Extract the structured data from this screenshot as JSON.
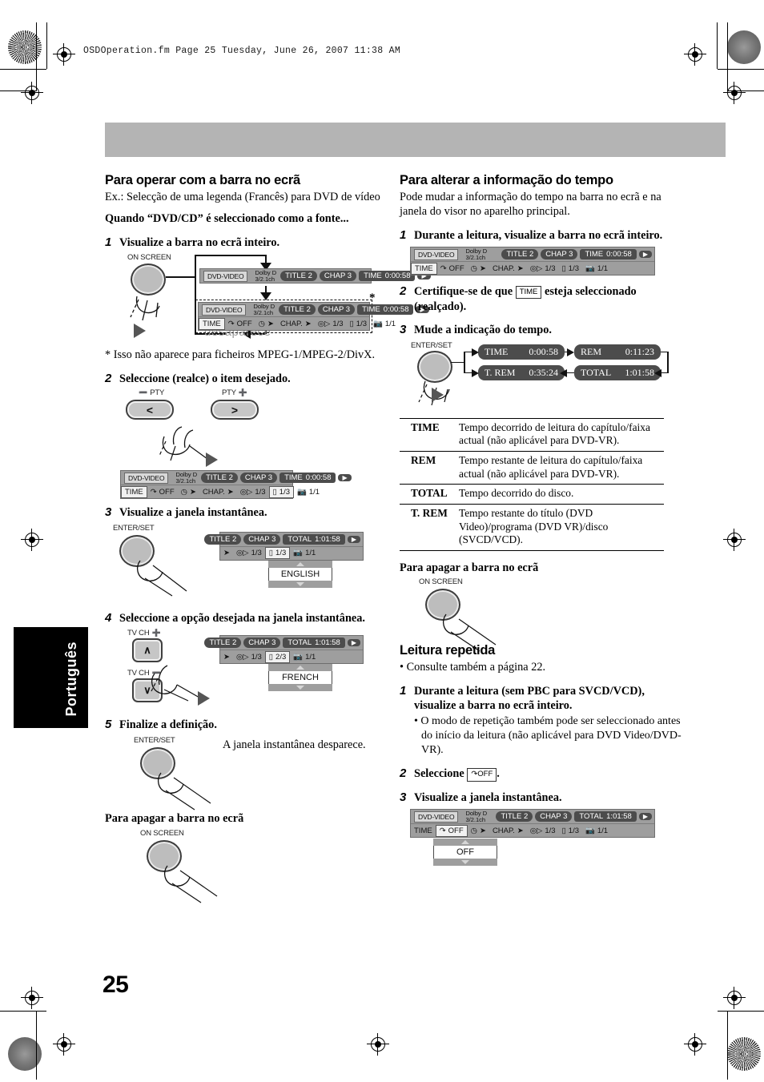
{
  "page": {
    "running_header": "OSDOperation.fm  Page 25  Tuesday, June 26, 2007   11:38 AM",
    "number": "25",
    "language_tab": "Português"
  },
  "left": {
    "heading": "Para operar com a barra no ecrã",
    "intro": "Ex.: Selecção de uma legenda (Francês) para DVD de vídeo",
    "subheading": "Quando “DVD/CD” é seleccionado como a fonte...",
    "step1": {
      "num": "1",
      "text": "Visualize a barra no ecrã inteiro."
    },
    "on_screen_label": "ON SCREEN",
    "disappear_label": "desaparece",
    "footnote": "* Isso não aparece para ficheiros MPEG-1/MPEG-2/DivX.",
    "step2": {
      "num": "2",
      "text": "Seleccione (realce) o item desejado."
    },
    "pty_minus": "PTY",
    "pty_plus": "PTY",
    "btn_left": "<",
    "btn_right": ">",
    "step3": {
      "num": "3",
      "text": "Visualize a janela instantânea."
    },
    "enter_set_label": "ENTER/SET",
    "popup_english": "ENGLISH",
    "step4": {
      "num": "4",
      "text": "Seleccione a opção desejada na janela instantânea."
    },
    "tvch_up": "TV CH",
    "tvch_dn": "TV CH",
    "btn_up": "∧",
    "btn_dn": "∨",
    "popup_french": "FRENCH",
    "step5": {
      "num": "5",
      "text": "Finalize a definição."
    },
    "step5_note": "A janela instantânea desparece.",
    "erase_heading": "Para apagar a barra no ecrã"
  },
  "right": {
    "heading": "Para alterar a informação do tempo",
    "intro": "Pode mudar a informação do tempo na barra no ecrã e na janela do visor no aparelho principal.",
    "step1": {
      "num": "1",
      "text": "Durante a leitura, visualize a barra no ecrã inteiro."
    },
    "step2": {
      "num": "2",
      "text_a": "Certifique-se de que",
      "chip": "TIME",
      "text_b": "esteja seleccionado (realçado)."
    },
    "step3": {
      "num": "3",
      "text": "Mude a indicação do tempo."
    },
    "enter_set_label": "ENTER/SET",
    "cycle": [
      {
        "label": "TIME",
        "value": "0:00:58"
      },
      {
        "label": "REM",
        "value": "0:11:23"
      },
      {
        "label": "TOTAL",
        "value": "1:01:58"
      },
      {
        "label": "T. REM",
        "value": "0:35:24"
      }
    ],
    "table": {
      "rows": [
        {
          "key": "TIME",
          "desc": "Tempo decorrido de leitura do capítulo/faixa actual (não aplicável para DVD-VR)."
        },
        {
          "key": "REM",
          "desc": "Tempo restante de leitura do capítulo/faixa actual (não aplicável para DVD-VR)."
        },
        {
          "key": "TOTAL",
          "desc": "Tempo decorrido do disco."
        },
        {
          "key": "T. REM",
          "desc": "Tempo restante do título (DVD Video)/programa (DVD VR)/disco (SVCD/VCD)."
        }
      ]
    },
    "erase_heading": "Para apagar a barra no ecrã",
    "on_screen_label": "ON SCREEN",
    "repeat_heading": "Leitura repetida",
    "repeat_bullet": "• Consulte também a página 22.",
    "rstep1": {
      "num": "1",
      "text": "Durante a leitura (sem PBC para SVCD/VCD), visualize a barra no ecrã inteiro.",
      "bullet": "• O modo de repetição também pode ser seleccionado antes do início da leitura (não aplicável para DVD Video/DVD-VR)."
    },
    "rstep2": {
      "num": "2",
      "text_a": "Seleccione",
      "chip": "OFF",
      "text_b": "."
    },
    "rstep3": {
      "num": "3",
      "text": "Visualize a janela instantânea."
    },
    "popup_off": "OFF"
  },
  "osd": {
    "media": "DVD-VIDEO",
    "dolby_line1": "Dolby D",
    "dolby_line2": "3/2.1ch",
    "title": "TITLE 2",
    "chap": "CHAP 3",
    "time_label": "TIME",
    "time_value": "0:00:58",
    "total_label": "TOTAL",
    "total_value": "1:01:58",
    "row2_time": "TIME",
    "row2_repeat": "OFF",
    "row2_chap": "CHAP.",
    "row2_audio": "1/3",
    "row2_sub": "1/3",
    "row2_sub_alt": "2/3",
    "row2_angle": "1/1"
  }
}
